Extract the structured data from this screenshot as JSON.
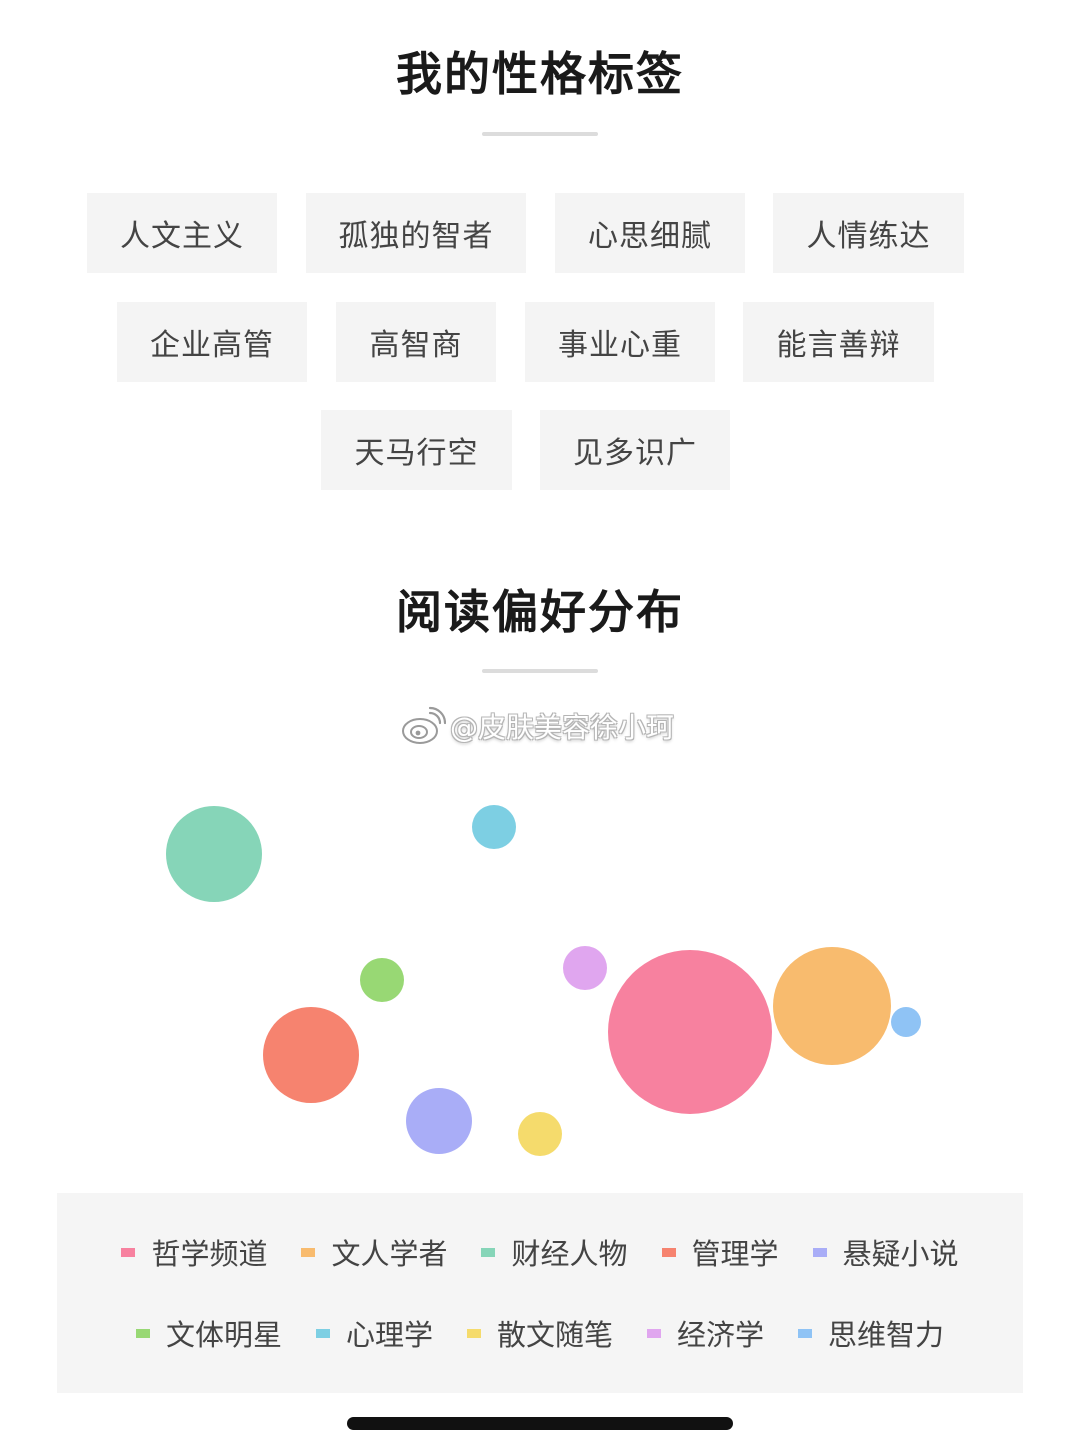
{
  "personality": {
    "title": "我的性格标签",
    "tags": [
      "人文主义",
      "孤独的智者",
      "心思细腻",
      "人情练达",
      "企业高管",
      "高智商",
      "事业心重",
      "能言善辩",
      "天马行空",
      "见多识广"
    ]
  },
  "reading": {
    "title": "阅读偏好分布"
  },
  "watermark": {
    "text": "@皮肤美容徐小珂",
    "icon": "weibo-icon"
  },
  "chart_data": {
    "type": "bubble",
    "series": [
      {
        "name": "哲学频道",
        "color": "#f7819f",
        "size": 82
      },
      {
        "name": "文人学者",
        "color": "#f8bb6e",
        "size": 59
      },
      {
        "name": "财经人物",
        "color": "#86d5b8",
        "size": 48
      },
      {
        "name": "管理学",
        "color": "#f6836f",
        "size": 48
      },
      {
        "name": "悬疑小说",
        "color": "#a9adf7",
        "size": 33
      },
      {
        "name": "文体明星",
        "color": "#98d874",
        "size": 22
      },
      {
        "name": "心理学",
        "color": "#7dcfe3",
        "size": 22
      },
      {
        "name": "散文随笔",
        "color": "#f5db6c",
        "size": 22
      },
      {
        "name": "经济学",
        "color": "#e0a6ef",
        "size": 22
      },
      {
        "name": "思维智力",
        "color": "#8fc3f5",
        "size": 15
      }
    ]
  }
}
